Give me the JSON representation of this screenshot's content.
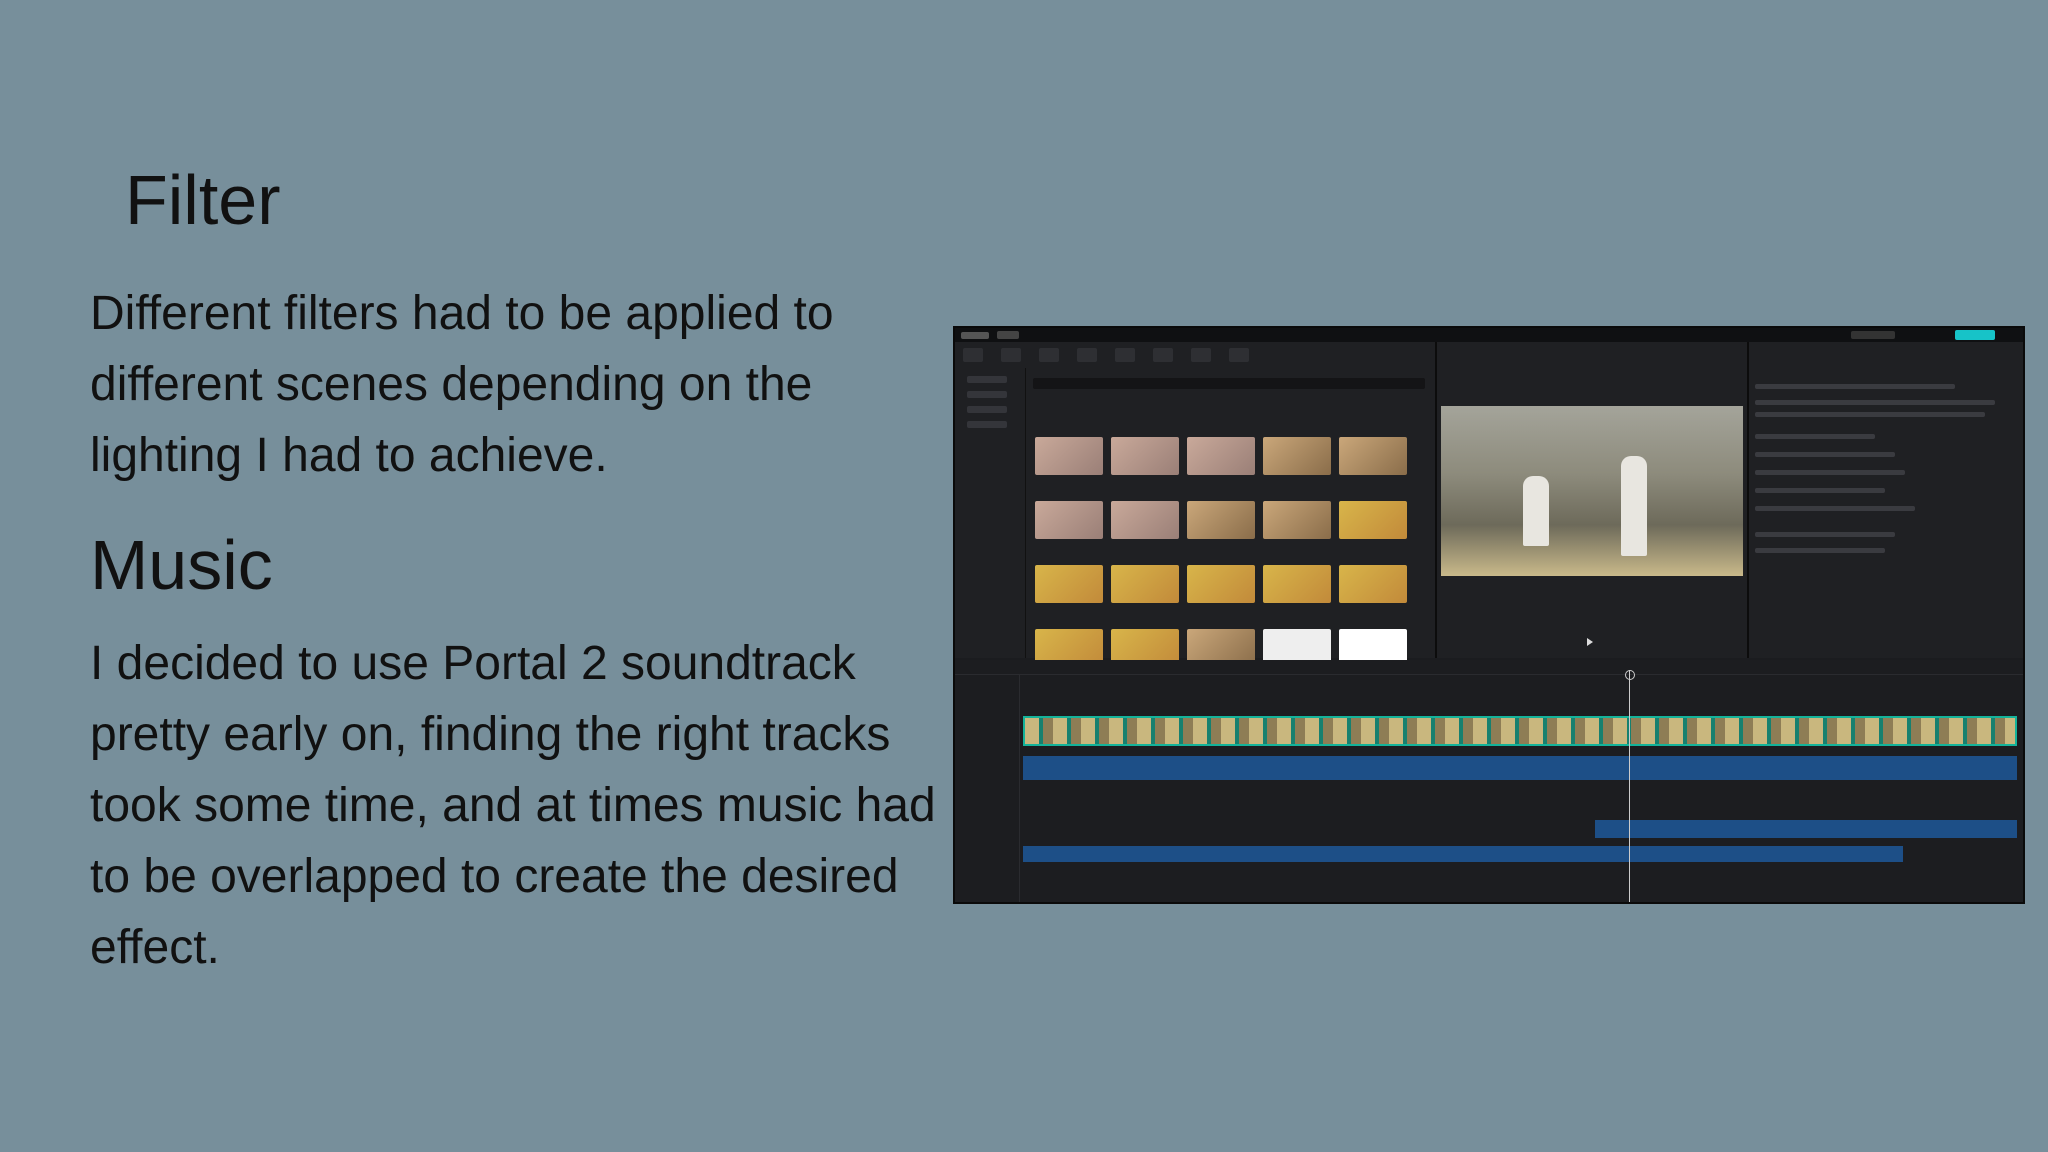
{
  "slide": {
    "filter_heading": "Filter",
    "filter_text": "Different filters had to be applied to different scenes depending on the lighting I had to achieve.",
    "music_heading": "Music",
    "music_text": "I decided to use Portal 2 soundtrack pretty early on, finding the right tracks took some time, and at times music had to be overlapped to create the desired effect."
  },
  "colors": {
    "background": "#778f9b",
    "editor_bg": "#1b1c1f",
    "video_track": "#14b39a",
    "audio_track": "#1d4f87",
    "export_button": "#17c3c8"
  },
  "editor_screenshot": {
    "icon_names": [
      "play-icon",
      "export-icon"
    ]
  }
}
